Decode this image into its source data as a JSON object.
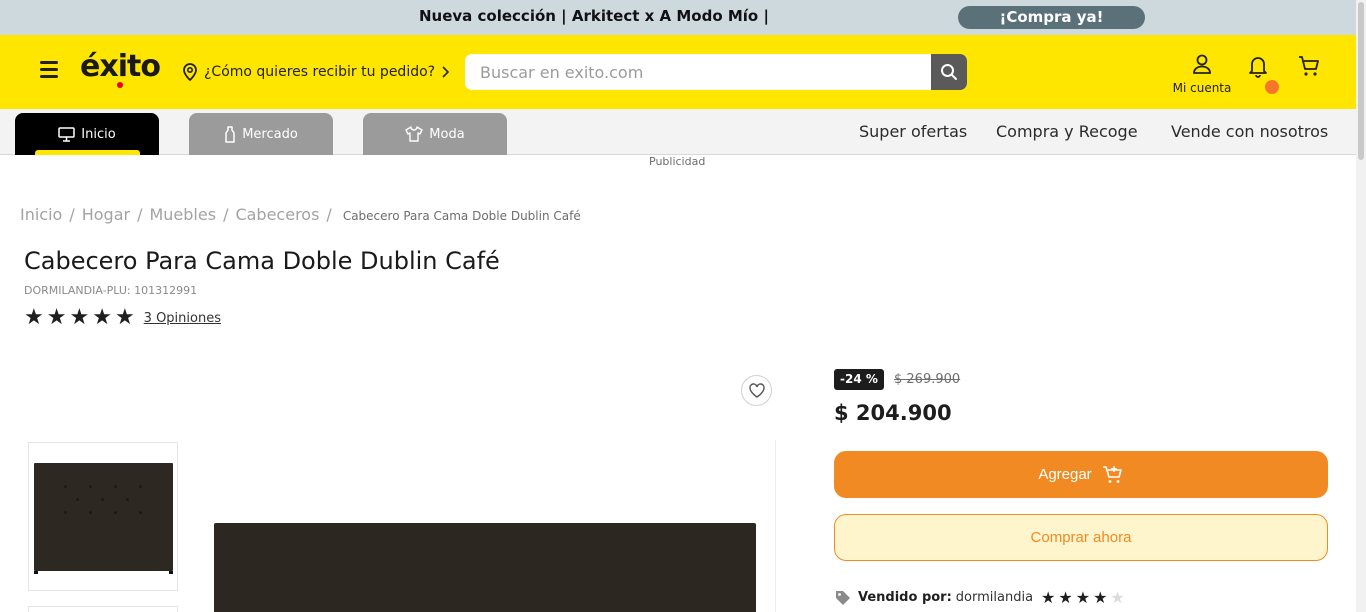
{
  "promo": {
    "text": "Nueva colección | Arkitect x A Modo Mío |",
    "cta": "¡Compra ya!"
  },
  "header": {
    "logo": "éxito",
    "delivery_prompt": "¿Cómo quieres recibir tu pedido?",
    "search_placeholder": "Buscar en exito.com",
    "account_label": "Mi cuenta",
    "icons": [
      "menu-icon",
      "location-pin-icon",
      "chevron-right-icon",
      "search-icon",
      "user-icon",
      "bell-icon",
      "cart-icon"
    ]
  },
  "nav": {
    "tabs": [
      {
        "label": "Inicio",
        "icon": "monitor-icon",
        "active": true
      },
      {
        "label": "Mercado",
        "icon": "bottle-icon",
        "active": false
      },
      {
        "label": "Moda",
        "icon": "shirt-icon",
        "active": false
      }
    ],
    "links": [
      "Super ofertas",
      "Compra y Recoge",
      "Vende con nosotros"
    ]
  },
  "ad_label": "Publicidad",
  "breadcrumb": {
    "items": [
      "Inicio",
      "Hogar",
      "Muebles",
      "Cabeceros"
    ],
    "separator": "/",
    "current": "Cabecero Para Cama Doble Dublin Café"
  },
  "product": {
    "title": "Cabecero Para Cama Doble Dublin Café",
    "sku": "DORMILANDIA-PLU: 101312991",
    "rating": 5,
    "reviews": "3 Opiniones",
    "discount": "-24 %",
    "old_price": "$ 269.900",
    "price": "$ 204.900",
    "add_button": "Agregar",
    "buy_button": "Comprar ahora",
    "seller_label": "Vendido por:",
    "seller_name": "dormilandia",
    "seller_rating": 4,
    "seller_rating_max": 5
  },
  "colors": {
    "brand_yellow": "#ffe600",
    "accent_orange": "#f28a24",
    "promo_bg": "#ced9de",
    "promo_btn": "#5b7179"
  }
}
